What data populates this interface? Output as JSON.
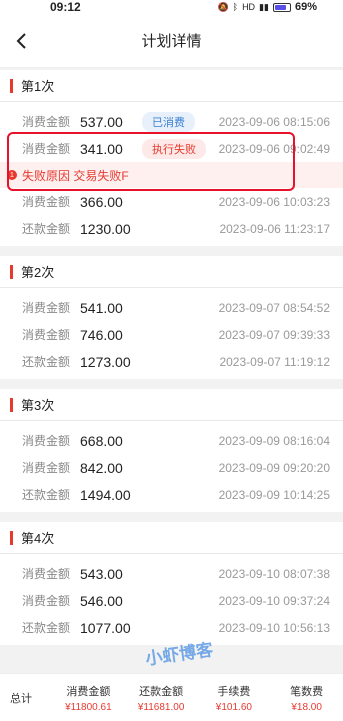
{
  "status": {
    "time": "09:12",
    "battery": "69%",
    "battery_level": 0.69,
    "network_badge": "HD"
  },
  "nav": {
    "title": "计划详情"
  },
  "plans": [
    {
      "title": "第1次",
      "rows": [
        {
          "label": "消费金额",
          "amount": "537.00",
          "badge": "已消费",
          "badge_type": "used",
          "time": "2023-09-06 08:15:06"
        },
        {
          "label": "消费金额",
          "amount": "341.00",
          "badge": "执行失败",
          "badge_type": "fail",
          "time": "2023-09-06 09:02:49",
          "fail_reason": "失败原因 交易失败F"
        },
        {
          "label": "消费金额",
          "amount": "366.00",
          "badge": "",
          "badge_type": "",
          "time": "2023-09-06 10:03:23"
        },
        {
          "label": "还款金额",
          "amount": "1230.00",
          "badge": "",
          "badge_type": "",
          "time": "2023-09-06 11:23:17"
        }
      ]
    },
    {
      "title": "第2次",
      "rows": [
        {
          "label": "消费金额",
          "amount": "541.00",
          "badge": "",
          "badge_type": "",
          "time": "2023-09-07 08:54:52"
        },
        {
          "label": "消费金额",
          "amount": "746.00",
          "badge": "",
          "badge_type": "",
          "time": "2023-09-07 09:39:33"
        },
        {
          "label": "还款金额",
          "amount": "1273.00",
          "badge": "",
          "badge_type": "",
          "time": "2023-09-07 11:19:12"
        }
      ]
    },
    {
      "title": "第3次",
      "rows": [
        {
          "label": "消费金额",
          "amount": "668.00",
          "badge": "",
          "badge_type": "",
          "time": "2023-09-09 08:16:04"
        },
        {
          "label": "消费金额",
          "amount": "842.00",
          "badge": "",
          "badge_type": "",
          "time": "2023-09-09 09:20:20"
        },
        {
          "label": "还款金额",
          "amount": "1494.00",
          "badge": "",
          "badge_type": "",
          "time": "2023-09-09 10:14:25"
        }
      ]
    },
    {
      "title": "第4次",
      "rows": [
        {
          "label": "消费金额",
          "amount": "543.00",
          "badge": "",
          "badge_type": "",
          "time": "2023-09-10 08:07:38"
        },
        {
          "label": "消费金额",
          "amount": "546.00",
          "badge": "",
          "badge_type": "",
          "time": "2023-09-10 09:37:24"
        },
        {
          "label": "还款金额",
          "amount": "1077.00",
          "badge": "",
          "badge_type": "",
          "time": "2023-09-10 10:56:13"
        }
      ]
    }
  ],
  "footer": {
    "total_label": "总计",
    "columns": [
      {
        "header": "消费金额",
        "value": "¥11800.61"
      },
      {
        "header": "还款金额",
        "value": "¥11681.00"
      },
      {
        "header": "手续费",
        "value": "¥101.60"
      },
      {
        "header": "笔数费",
        "value": "¥18.00"
      }
    ]
  },
  "watermark": "小虾博客",
  "colors": {
    "accent": "#e8392f",
    "link_blue": "#3a7fd0",
    "highlight": "#e8102a"
  }
}
